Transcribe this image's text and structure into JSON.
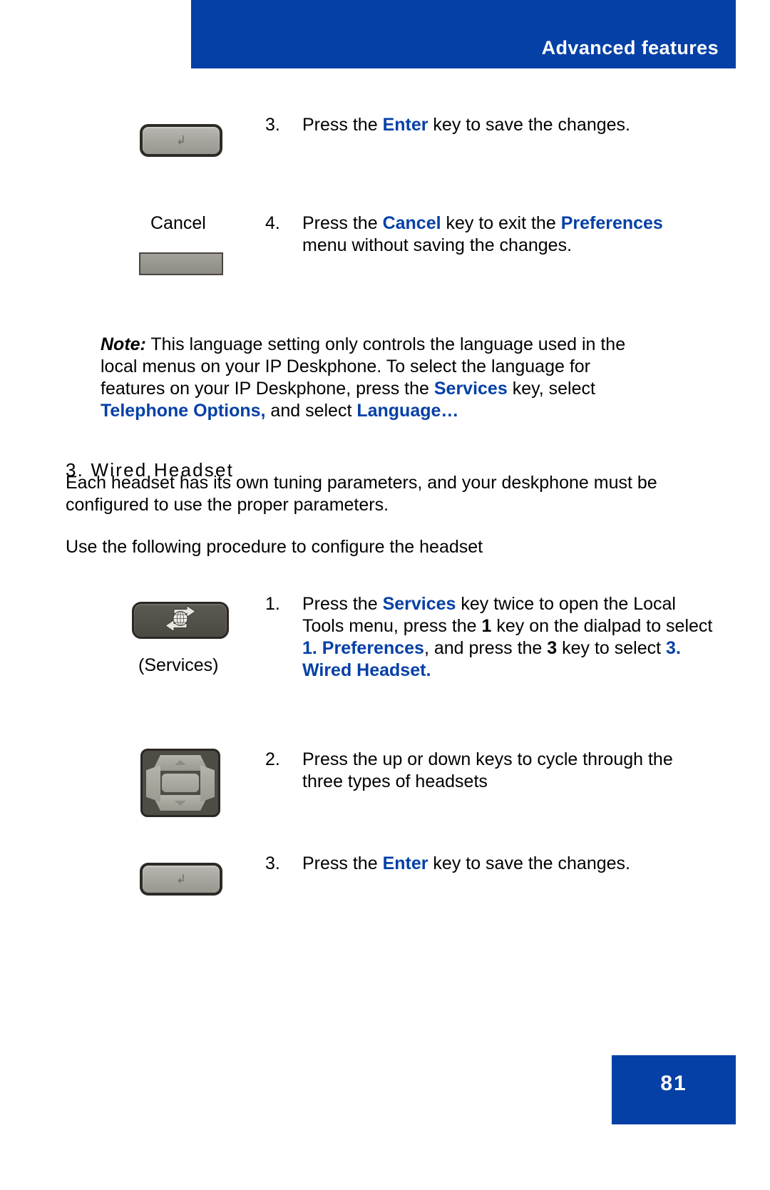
{
  "header": {
    "title": "Advanced features"
  },
  "steps_top": [
    {
      "number": "3.",
      "key_icon": "enter-key-icon",
      "caption": "",
      "text_runs": [
        {
          "t": "Press the ",
          "s": "plain"
        },
        {
          "t": "Enter",
          "s": "blue-bold"
        },
        {
          "t": " key to save the changes.",
          "s": "plain"
        }
      ]
    },
    {
      "number": "4.",
      "key_icon": "cancel-softkey-icon",
      "caption": "Cancel",
      "text_runs": [
        {
          "t": "Press the ",
          "s": "plain"
        },
        {
          "t": "Cancel",
          "s": "blue-bold"
        },
        {
          "t": " key to exit the ",
          "s": "plain"
        },
        {
          "t": "Preferences",
          "s": "blue-bold"
        },
        {
          "t": " menu without saving the changes.",
          "s": "plain"
        }
      ]
    }
  ],
  "note": {
    "lead": "Note:",
    "runs": [
      {
        "t": " This language setting only controls the language used in the local menus on your IP Deskphone. To select the language for features on your IP Deskphone, press the ",
        "s": "plain"
      },
      {
        "t": "Services",
        "s": "blue-bold"
      },
      {
        "t": " key, select ",
        "s": "plain"
      },
      {
        "t": "Telephone Options,",
        "s": "blue-bold"
      },
      {
        "t": " and select ",
        "s": "plain"
      },
      {
        "t": "Language…",
        "s": "blue-bold"
      }
    ]
  },
  "section": {
    "heading": "3. Wired Headset",
    "para1": "Each headset has its own tuning parameters, and your deskphone must be configured to use the proper parameters.",
    "para2": "Use the following procedure to configure the headset"
  },
  "steps_bottom": [
    {
      "number": "1.",
      "key_icon": "services-key-icon",
      "caption": "(Services)",
      "text_runs": [
        {
          "t": "Press the ",
          "s": "plain"
        },
        {
          "t": "Services",
          "s": "blue-bold"
        },
        {
          "t": " key twice to open the Local Tools menu, press the ",
          "s": "plain"
        },
        {
          "t": "1",
          "s": "black-bold"
        },
        {
          "t": " key on the dialpad to select ",
          "s": "plain"
        },
        {
          "t": "1. Preferences",
          "s": "blue-bold"
        },
        {
          "t": ", and press the ",
          "s": "plain"
        },
        {
          "t": "3",
          "s": "black-bold"
        },
        {
          "t": " key to select ",
          "s": "plain"
        },
        {
          "t": "3. Wired Headset.",
          "s": "blue-bold"
        }
      ]
    },
    {
      "number": "2.",
      "key_icon": "navigation-key-icon",
      "caption": "",
      "text_runs": [
        {
          "t": "Press the up or down keys to cycle through the three types of headsets",
          "s": "plain"
        }
      ]
    },
    {
      "number": "3.",
      "key_icon": "enter-key-icon",
      "caption": "",
      "text_runs": [
        {
          "t": "Press the ",
          "s": "plain"
        },
        {
          "t": "Enter",
          "s": "blue-bold"
        },
        {
          "t": " key to save the changes.",
          "s": "plain"
        }
      ]
    }
  ],
  "footer": {
    "page_number": "81"
  },
  "colors": {
    "brand_blue": "#0540a6",
    "text_black": "#000000",
    "page_white": "#ffffff"
  }
}
